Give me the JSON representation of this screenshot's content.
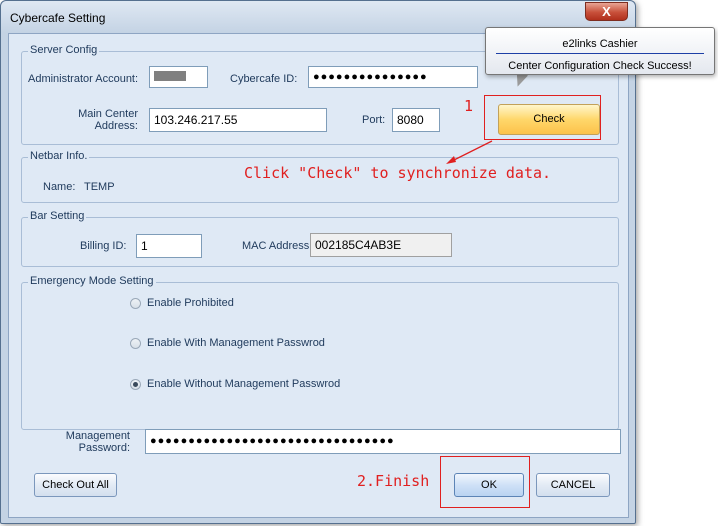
{
  "window": {
    "title": "Cybercafe Setting",
    "close_glyph": "X"
  },
  "server_config": {
    "title": "Server Config",
    "admin_label": "Administrator Account:",
    "cybercafe_id_label": "Cybercafe ID:",
    "cybercafe_id_value": "●●●●●●●●●●●●●●●",
    "main_center_label_1": "Main Center",
    "main_center_label_2": "Address:",
    "main_center_value": "103.246.217.55",
    "port_label": "Port:",
    "port_value": "8080",
    "check_label": "Check"
  },
  "netbar": {
    "title": "Netbar Info.",
    "name_label": "Name:",
    "name_value": "TEMP"
  },
  "bar_setting": {
    "title": "Bar Setting",
    "billing_id_label": "Billing ID:",
    "billing_id_value": "1",
    "mac_label": "MAC Address:",
    "mac_value": "002185C4AB3E"
  },
  "emergency": {
    "title": "Emergency Mode Setting",
    "options": [
      {
        "label": "Enable Prohibited",
        "checked": false
      },
      {
        "label": "Enable With Management Passwrod",
        "checked": false
      },
      {
        "label": "Enable Without Management Passwrod",
        "checked": true
      }
    ]
  },
  "management": {
    "label_1": "Management",
    "label_2": "Password:",
    "value": "●●●●●●●●●●●●●●●●●●●●●●●●●●●●●●●●"
  },
  "buttons": {
    "check_out_all": "Check Out All",
    "ok": "OK",
    "cancel": "CANCEL"
  },
  "annotations": {
    "step1": "1",
    "instruction": "Click \"Check\" to synchronize data.",
    "step2": "2.Finish"
  },
  "tooltip": {
    "title": "e2links Cashier",
    "message": "Center Configuration Check Success!"
  },
  "colors": {
    "annotation_red": "#e02020",
    "check_button": "#fcc24b",
    "window_frame": "#c4d3e4"
  }
}
